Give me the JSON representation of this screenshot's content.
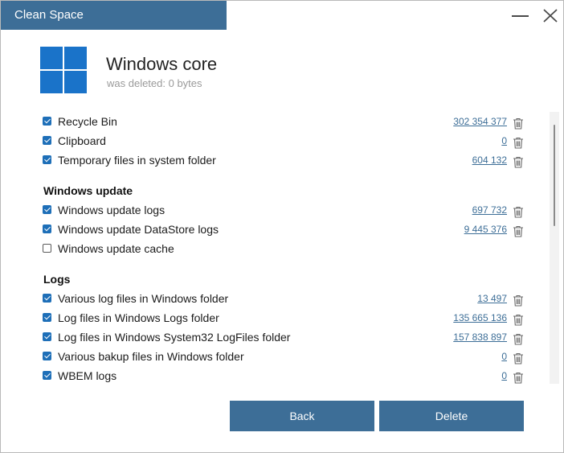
{
  "window": {
    "title": "Clean Space"
  },
  "header": {
    "title": "Windows core",
    "subtitle": "was deleted: 0 bytes"
  },
  "groups": [
    {
      "title": "",
      "items": [
        {
          "label": "Recycle Bin",
          "size": "302 354 377",
          "checked": true
        },
        {
          "label": "Clipboard",
          "size": "0",
          "checked": true
        },
        {
          "label": "Temporary files in system folder",
          "size": "604 132",
          "checked": true
        }
      ]
    },
    {
      "title": "Windows update",
      "items": [
        {
          "label": "Windows update logs",
          "size": "697 732",
          "checked": true
        },
        {
          "label": "Windows update DataStore logs",
          "size": "9 445 376",
          "checked": true
        },
        {
          "label": "Windows update cache",
          "size": "",
          "checked": false
        }
      ]
    },
    {
      "title": "Logs",
      "items": [
        {
          "label": "Various log files in Windows folder",
          "size": "13 497",
          "checked": true
        },
        {
          "label": "Log files in Windows Logs folder",
          "size": "135 665 136",
          "checked": true
        },
        {
          "label": "Log files in Windows System32 LogFiles folder",
          "size": "157 838 897",
          "checked": true
        },
        {
          "label": "Various bakup files in Windows folder",
          "size": "0",
          "checked": true
        },
        {
          "label": "WBEM logs",
          "size": "0",
          "checked": true
        }
      ]
    }
  ],
  "buttons": {
    "back": "Back",
    "delete": "Delete"
  },
  "colors": {
    "accent": "#3d6e97",
    "checkbox": "#1e6fb8",
    "logo": "#1a73c9"
  },
  "icons": {
    "logo": "windows-logo-icon",
    "trash": "trash-icon",
    "minimize": "minimize-icon",
    "close": "close-icon"
  }
}
